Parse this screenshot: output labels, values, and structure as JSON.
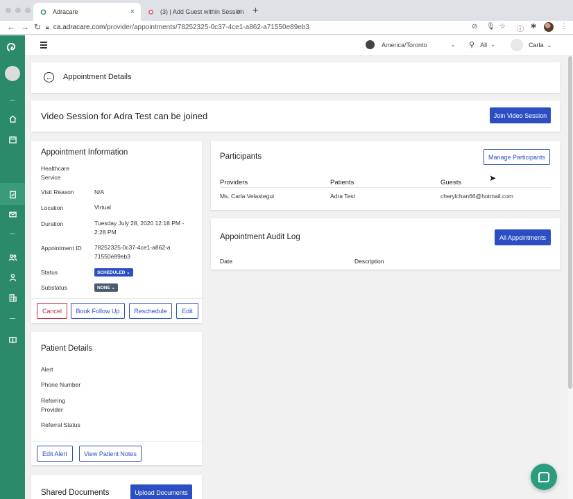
{
  "browser": {
    "tabs": [
      {
        "label": "Adracare",
        "active": true
      },
      {
        "label": "(3) | Add Guest within Session",
        "active": false
      }
    ],
    "url_domain": "ca.adracare.com",
    "url_path": "/provider/appointments/78252325-0c37-4ce1-a862-a71550e89eb3"
  },
  "topbar": {
    "timezone": "America/Toronto",
    "location_filter": "All",
    "user_name": "Carla"
  },
  "page": {
    "title": "Appointment Details"
  },
  "video_session": {
    "message": "Video Session for Adra Test can be joined",
    "join_label": "Join Video Session"
  },
  "appointment_info": {
    "title": "Appointment Information",
    "fields": [
      {
        "label": "Healthcare Service",
        "value": ""
      },
      {
        "label": "Visit Reason",
        "value": "N/A"
      },
      {
        "label": "Location",
        "value": "Virtual"
      },
      {
        "label": "Duration",
        "value": "Tuesday July 28, 2020 12:18 PM - 2:28 PM"
      },
      {
        "label": "Appointment ID",
        "value": "78252325-0c37-4ce1-a862-a71550e89eb3"
      }
    ],
    "status_label": "Status",
    "status_value": "SCHEDULED",
    "substatus_label": "Substatus",
    "substatus_value": "NONE",
    "actions": {
      "cancel": "Cancel",
      "book_follow_up": "Book Follow Up",
      "reschedule": "Reschedule",
      "edit": "Edit"
    }
  },
  "patient_details": {
    "title": "Patient Details",
    "fields": [
      "Alert",
      "Phone Number",
      "Referring Provider",
      "Referral Status"
    ],
    "actions": {
      "edit_alert": "Edit Alert",
      "view_notes": "View Patient Notes"
    }
  },
  "shared_documents": {
    "title": "Shared Documents",
    "upload_label": "Upload Documents"
  },
  "participants": {
    "title": "Participants",
    "manage_label": "Manage Participants",
    "columns": [
      "Providers",
      "Patients",
      "Guests"
    ],
    "row": [
      "Ms. Carla Velastegui",
      "Adra Test",
      "cherylchan66@hotmail.com"
    ]
  },
  "audit_log": {
    "title": "Appointment Audit Log",
    "all_label": "All Appointments",
    "columns": [
      "Date",
      "Description"
    ]
  },
  "colors": {
    "primary": "#2b4fc2",
    "danger": "#c8283a",
    "sidebar": "#2a8a6a",
    "status_badge": "#2b4fc2",
    "substatus_badge": "#4a5a70"
  }
}
